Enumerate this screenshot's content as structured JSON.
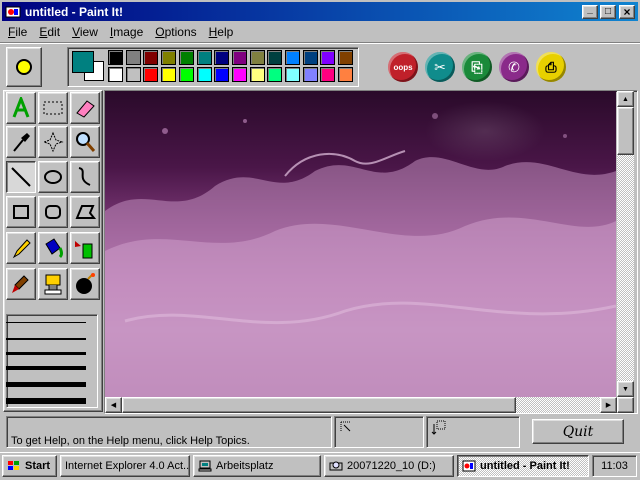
{
  "window": {
    "title": "untitled - Paint It!",
    "controls": {
      "minimize": "_",
      "maximize": "□",
      "close": "×"
    }
  },
  "menu": [
    {
      "label": "File",
      "access": "F",
      "rest": "ile"
    },
    {
      "label": "Edit",
      "access": "E",
      "rest": "dit"
    },
    {
      "label": "View",
      "access": "V",
      "rest": "iew"
    },
    {
      "label": "Image",
      "access": "I",
      "rest": "mage"
    },
    {
      "label": "Options",
      "access": "O",
      "rest": "ptions"
    },
    {
      "label": "Help",
      "access": "H",
      "rest": "elp"
    }
  ],
  "colors": {
    "foreground": "#008080",
    "background": "#ffffff",
    "palette_row1": [
      "#000000",
      "#808080",
      "#800000",
      "#808000",
      "#008000",
      "#008080",
      "#000080",
      "#800080",
      "#808040",
      "#004040",
      "#0080ff",
      "#004080",
      "#8000ff",
      "#804000"
    ],
    "palette_row2": [
      "#ffffff",
      "#c0c0c0",
      "#ff0000",
      "#ffff00",
      "#00ff00",
      "#00ffff",
      "#0000ff",
      "#ff00ff",
      "#ffff80",
      "#00ff80",
      "#80ffff",
      "#8080ff",
      "#ff0080",
      "#ff8040"
    ]
  },
  "action_buttons": [
    {
      "name": "oops-button",
      "label": "oops",
      "color": "#c0202a"
    },
    {
      "name": "cut-button",
      "label": "",
      "color": "#108c8c"
    },
    {
      "name": "copy-button",
      "label": "",
      "color": "#1a8a3a"
    },
    {
      "name": "paste-button",
      "label": "",
      "color": "#8a2a8a"
    },
    {
      "name": "print-button",
      "label": "",
      "color": "#e8d000"
    }
  ],
  "current_tool_color": "#ffff00",
  "status": {
    "help_text": "To get Help, on the Help menu, click Help Topics."
  },
  "quit_label": "Quit",
  "taskbar": {
    "start_label": "Start",
    "tasks": [
      {
        "label": "Internet Explorer 4.0 Act...",
        "active": false
      },
      {
        "label": "Arbeitsplatz",
        "active": false
      },
      {
        "label": "20071220_10 (D:)",
        "active": false
      },
      {
        "label": "untitled - Paint It!",
        "active": true
      }
    ],
    "clock": "11:03"
  }
}
